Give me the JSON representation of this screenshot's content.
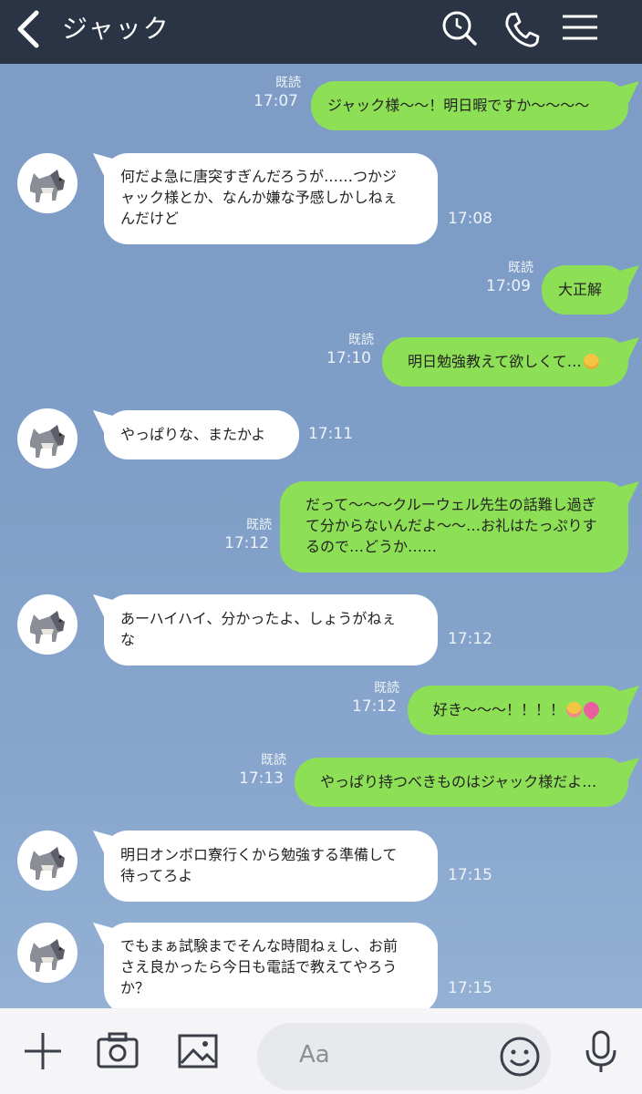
{
  "header": {
    "title": "ジャック"
  },
  "messages": [
    {
      "dir": "out",
      "read": "既読",
      "time": "17:07",
      "lines": [
        "ジャック様〜〜！明日暇ですか〜〜〜〜"
      ]
    },
    {
      "dir": "in",
      "time": "17:08",
      "lines": [
        "何だよ急に唐突すぎんだろうが……つかジ",
        "ャック様とか、なんか嫌な予感しかしねぇ",
        "んだけど"
      ]
    },
    {
      "dir": "out",
      "read": "既読",
      "time": "17:09",
      "lines": [
        "大正解"
      ]
    },
    {
      "dir": "out",
      "read": "既読",
      "time": "17:10",
      "lines": [
        "明日勉強教えて欲しくて…"
      ],
      "emoji": [
        "pleading-emoji"
      ]
    },
    {
      "dir": "in",
      "time": "17:11",
      "lines": [
        "やっぱりな、またかよ"
      ]
    },
    {
      "dir": "out",
      "read": "既読",
      "time": "17:12",
      "lines": [
        "だって〜〜〜クルーウェル先生の話難し過ぎ",
        "て分からないんだよ〜〜…お礼はたっぷりす",
        "るので…どうか……"
      ]
    },
    {
      "dir": "in",
      "time": "17:12",
      "lines": [
        "あーハイハイ、分かったよ、しょうがねぇ",
        "な"
      ]
    },
    {
      "dir": "out",
      "read": "既読",
      "time": "17:12",
      "lines": [
        "好き〜〜〜！！！！"
      ],
      "emoji": [
        "blushing-emoji",
        "heart-emoji"
      ]
    },
    {
      "dir": "out",
      "read": "既読",
      "time": "17:13",
      "lines": [
        "やっぱり持つべきものはジャック様だよ…"
      ]
    },
    {
      "dir": "in",
      "time": "17:15",
      "lines": [
        "明日オンボロ寮行くから勉強する準備して",
        "待ってろよ"
      ]
    },
    {
      "dir": "in",
      "time": "17:15",
      "lines": [
        "でもまぁ試験までそんな時間ねぇし、お前",
        "さえ良かったら今日も電話で教えてやろう",
        "か？"
      ]
    }
  ],
  "footer": {
    "input_placeholder": "Aa"
  },
  "icons": [
    "back-icon",
    "search-icon",
    "phone-icon",
    "menu-icon",
    "plus-icon",
    "camera-icon",
    "image-icon",
    "emoji-icon",
    "mic-icon"
  ],
  "colors": {
    "header": "#2b3445",
    "outgoing": "#8de055",
    "incoming": "#ffffff",
    "background": "#7e9dc6"
  }
}
